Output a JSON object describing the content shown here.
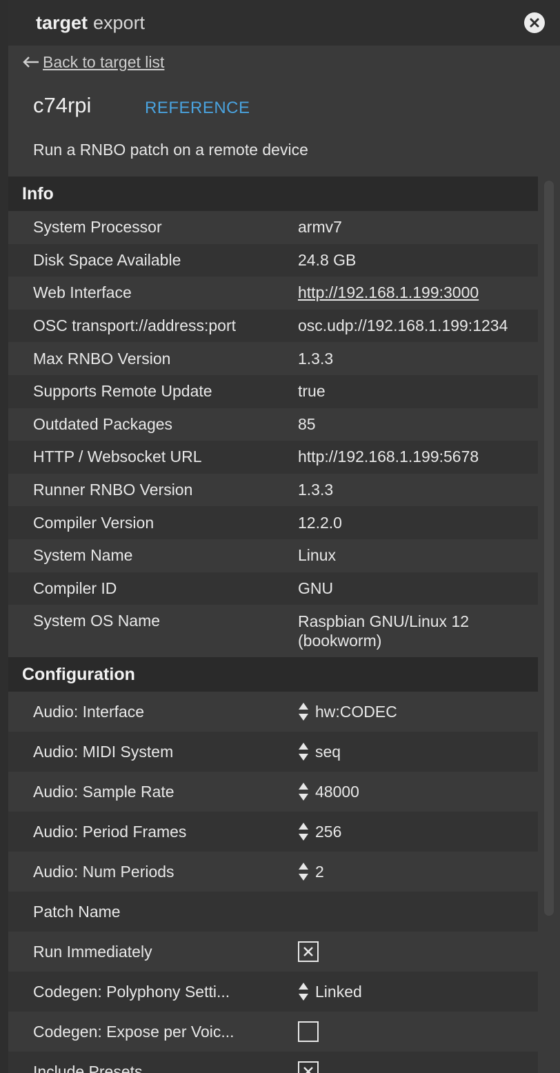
{
  "header": {
    "title_bold": "target",
    "title_light": "export"
  },
  "back_link": {
    "label": "Back to target list"
  },
  "device": {
    "name": "c74rpi",
    "reference_label": "REFERENCE",
    "description": "Run a RNBO patch on a remote device"
  },
  "info": {
    "title": "Info",
    "rows": [
      {
        "label": "System Processor",
        "value": "armv7"
      },
      {
        "label": "Disk Space Available",
        "value": "24.8 GB"
      },
      {
        "label": "Web Interface",
        "value": "http://192.168.1.199:3000"
      },
      {
        "label": "OSC transport://address:port",
        "value": "osc.udp://192.168.1.199:1234"
      },
      {
        "label": "Max RNBO Version",
        "value": "1.3.3"
      },
      {
        "label": "Supports Remote Update",
        "value": "true"
      },
      {
        "label": "Outdated Packages",
        "value": "85"
      },
      {
        "label": "HTTP / Websocket URL",
        "value": "http://192.168.1.199:5678"
      },
      {
        "label": "Runner RNBO Version",
        "value": "1.3.3"
      },
      {
        "label": "Compiler Version",
        "value": "12.2.0"
      },
      {
        "label": "System Name",
        "value": "Linux"
      },
      {
        "label": "Compiler ID",
        "value": "GNU"
      },
      {
        "label": "System OS Name",
        "value": "Raspbian GNU/Linux 12 (bookworm)"
      }
    ]
  },
  "configuration": {
    "title": "Configuration",
    "rows": [
      {
        "label": "Audio: Interface",
        "value": "hw:CODEC"
      },
      {
        "label": "Audio: MIDI System",
        "value": "seq"
      },
      {
        "label": "Audio: Sample Rate",
        "value": "48000"
      },
      {
        "label": "Audio: Period Frames",
        "value": "256"
      },
      {
        "label": "Audio: Num Periods",
        "value": "2"
      },
      {
        "label": "Patch Name",
        "value": ""
      },
      {
        "label": "Run Immediately",
        "checked": true
      },
      {
        "label": "Codegen: Polyphony Setti...",
        "value": "Linked"
      },
      {
        "label": "Codegen: Expose per Voic...",
        "checked": false
      },
      {
        "label": "Include Presets",
        "checked": true
      }
    ]
  }
}
